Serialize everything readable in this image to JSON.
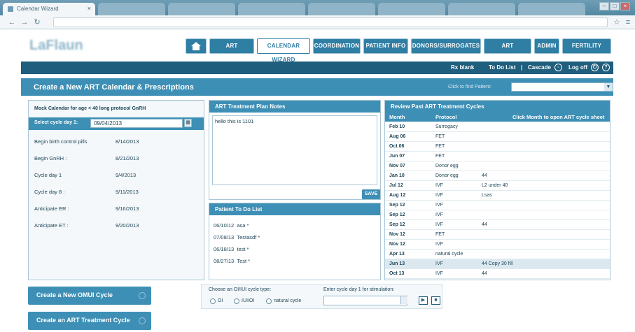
{
  "browser": {
    "tab_title": "Calendar Wizard",
    "tab_close": "×",
    "win_controls": [
      "–",
      "□",
      "×"
    ]
  },
  "nav": {
    "home_label": "",
    "items": [
      "ART SCHEDULE",
      "CALENDAR WIZARD",
      "COORDINATION",
      "PATIENT INFO",
      "DONORS/SURROGATES",
      "ART PROTOCOLS",
      "ADMIN",
      "FERTILITY CHART"
    ],
    "active": "CALENDAR WIZARD"
  },
  "toolbar": {
    "rx_blank": "Rx blank",
    "to_do_list": "To Do List",
    "separator": "|",
    "cascade": "Cascade",
    "log_off": "Log off"
  },
  "panel": {
    "title": "Create a New ART Calendar & Prescriptions",
    "find_label": "Click to find Patient:",
    "find_value": ""
  },
  "mock": {
    "label": "Mock Calendar for age < 40 long protocol GnRH",
    "cycle_label": "Select cycle day 1:",
    "cycle_value": "09/04/2013",
    "rows": [
      {
        "label": "Begin birth control pills",
        "value": "8/14/2013"
      },
      {
        "label": "Begin GnRH :",
        "value": "8/21/2013"
      },
      {
        "label": "Cycle day 1",
        "value": "9/4/2013"
      },
      {
        "label": "Cycle day 8 :",
        "value": "9/11/2013"
      },
      {
        "label": "Anticipate ER :",
        "value": "9/16/2013"
      },
      {
        "label": "Anticipate ET :",
        "value": "9/20/2013"
      }
    ]
  },
  "notes": {
    "title": "ART Treatment Plan Notes",
    "text": "hello this is 1101",
    "save": "SAVE"
  },
  "todo": {
    "title": "Patient To Do List",
    "items": [
      {
        "date": "06/10/12",
        "text": "asa *"
      },
      {
        "date": "07/08/13",
        "text": "Testasdf *"
      },
      {
        "date": "06/18/13",
        "text": "test *"
      },
      {
        "date": "08/27/13",
        "text": "Test *"
      }
    ]
  },
  "review": {
    "title": "Review Past ART Treatment Cycles",
    "col_month": "Month",
    "col_protocol": "Protocol",
    "hint": "Click Month to open ART cycle sheet",
    "rows": [
      {
        "month": "Feb 10",
        "protocol": "Surrogacy",
        "note": ""
      },
      {
        "month": "Aug 06",
        "protocol": "FET",
        "note": ""
      },
      {
        "month": "Oct 06",
        "protocol": "FET",
        "note": ""
      },
      {
        "month": "Jun 07",
        "protocol": "FET",
        "note": ""
      },
      {
        "month": "Nov 07",
        "protocol": "Donor egg",
        "note": ""
      },
      {
        "month": "Jan 10",
        "protocol": "Donor egg",
        "note": "44"
      },
      {
        "month": "Jul 12",
        "protocol": "IVF",
        "note": "L2 under 40"
      },
      {
        "month": "Aug 12",
        "protocol": "IVF",
        "note": "Lsas"
      },
      {
        "month": "Sep 12",
        "protocol": "IVF",
        "note": ""
      },
      {
        "month": "Sep 12",
        "protocol": "IVF",
        "note": ""
      },
      {
        "month": "Sep 12",
        "protocol": "IVF",
        "note": "44"
      },
      {
        "month": "Nov 12",
        "protocol": "FET",
        "note": ""
      },
      {
        "month": "Nov 12",
        "protocol": "IVF",
        "note": ""
      },
      {
        "month": "Apr 13",
        "protocol": "natural cycle",
        "note": ""
      },
      {
        "month": "Jun 13",
        "protocol": "IVF",
        "note": "44 Copy 30 fill"
      },
      {
        "month": "Oct 13",
        "protocol": "IVF",
        "note": "44"
      }
    ]
  },
  "bottom": {
    "btn_ohr": "Create a New OMUI Cycle",
    "btn_art": "Create an ART Treatment Cycle",
    "choose_label": "Choose an OI/IUI cycle type:",
    "options": [
      "OI",
      "IUI/OI",
      "natural cycle"
    ],
    "stim_label": "Enter cycle day 1 for stimulation:"
  }
}
